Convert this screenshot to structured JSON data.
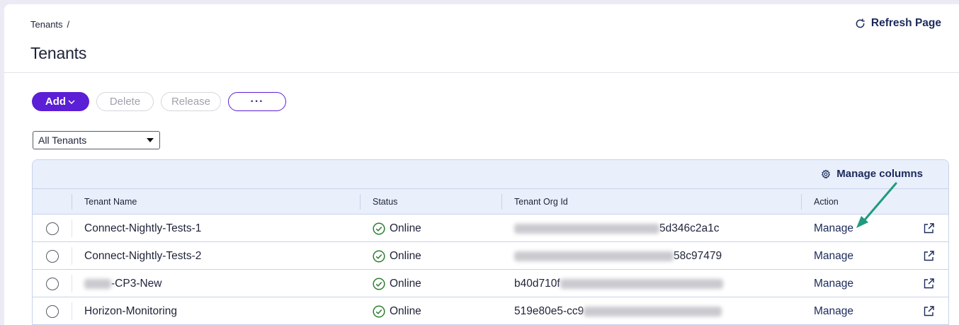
{
  "breadcrumb": {
    "item": "Tenants",
    "separator": "/"
  },
  "page": {
    "title": "Tenants",
    "refresh_label": "Refresh Page"
  },
  "toolbar": {
    "add_label": "Add",
    "delete_label": "Delete",
    "release_label": "Release",
    "more_label": "···"
  },
  "filter": {
    "selected": "All Tenants"
  },
  "grid": {
    "manage_columns_label": "Manage columns",
    "columns": [
      "Tenant Name",
      "Status",
      "Tenant Org Id",
      "Action"
    ],
    "rows": [
      {
        "name_prefix": "",
        "name": "Connect-Nightly-Tests-1",
        "status": "Online",
        "org_prefix": "",
        "org_suffix": "5d346c2a1c",
        "action": "Manage"
      },
      {
        "name_prefix": "",
        "name": "Connect-Nightly-Tests-2",
        "status": "Online",
        "org_prefix": "",
        "org_suffix": "58c97479",
        "action": "Manage"
      },
      {
        "name_prefix": "",
        "name": "-CP3-New",
        "status": "Online",
        "org_prefix": "b40d710f",
        "org_suffix": "",
        "action": "Manage"
      },
      {
        "name_prefix": "",
        "name": "Horizon-Monitoring",
        "status": "Online",
        "org_prefix": "519e80e5-cc9",
        "org_suffix": "",
        "action": "Manage"
      }
    ]
  },
  "colors": {
    "accent": "#5b1fd6",
    "link": "#1b2a5b",
    "online": "#2e7d32",
    "annotation_arrow": "#1f9a7e"
  },
  "icons": {
    "refresh": "refresh-icon",
    "gear": "gear-icon",
    "status": "check-circle-icon",
    "external": "external-link-icon",
    "dropdown": "caret-down-icon"
  }
}
